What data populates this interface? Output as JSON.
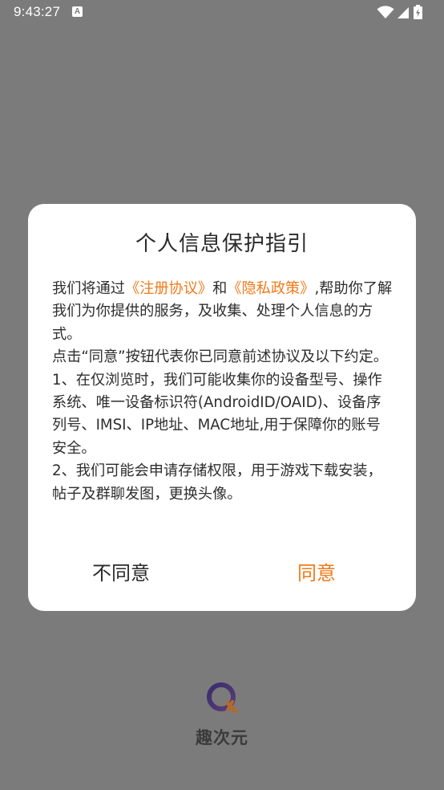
{
  "status_bar": {
    "time": "9:43:27",
    "notification_icon": "A"
  },
  "dialog": {
    "title": "个人信息保护指引",
    "body": {
      "p1_prefix": "我们将通过",
      "link_register": "《注册协议》",
      "p1_and": "和",
      "link_privacy": "《隐私政策》",
      "p1_suffix": ",帮助你了解我们为你提供的服务，及收集、处理个人信息的方式。",
      "p2": "点击“同意”按钮代表你已同意前述协议及以下约定。",
      "p3": "1、在仅浏览时，我们可能收集你的设备型号、操作系统、唯一设备标识符(AndroidID/OAID)、设备序列号、IMSI、IP地址、MAC地址,用于保障你的账号安全。",
      "p4": "2、我们可能会申请存储权限，用于游戏下载安装，帖子及群聊发图，更换头像。"
    },
    "buttons": {
      "disagree": "不同意",
      "agree": "同意"
    }
  },
  "brand": {
    "name": "趣次元"
  },
  "colors": {
    "accent": "#f07a1a",
    "overlay": "#7b7b7b"
  }
}
